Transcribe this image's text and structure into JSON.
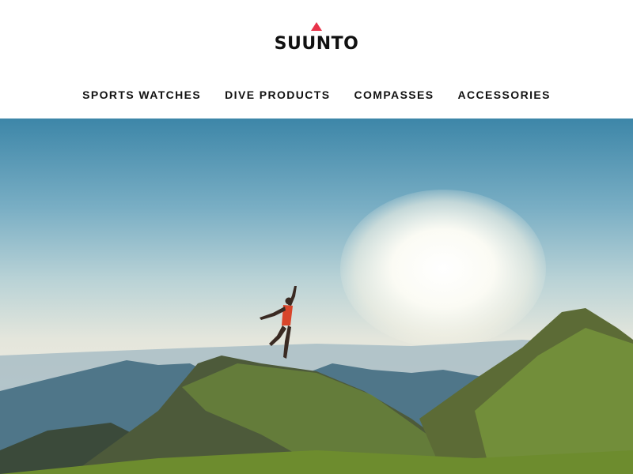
{
  "brand": {
    "name": "SUUNTO",
    "accent": "#e8334a"
  },
  "nav": {
    "items": [
      {
        "label": "SPORTS WATCHES"
      },
      {
        "label": "DIVE PRODUCTS"
      },
      {
        "label": "COMPASSES"
      },
      {
        "label": "ACCESSORIES"
      }
    ]
  },
  "hero": {
    "image": "runner-jumping-on-mountain-ridge-at-sunrise"
  }
}
